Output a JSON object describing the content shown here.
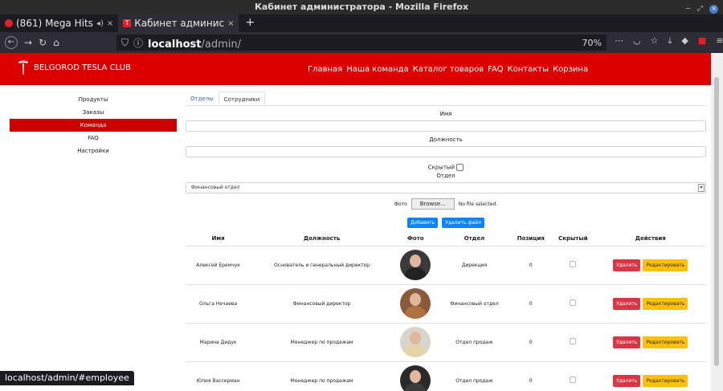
{
  "window": {
    "title": "Кабинет администратора - Mozilla Firefox"
  },
  "tabs": [
    {
      "label": "(861) Mega Hits",
      "close": "×"
    },
    {
      "label": "Кабинет админис",
      "close": "×"
    }
  ],
  "newtab": "+",
  "address": {
    "host": "localhost",
    "path": "/admin/",
    "zoom": "70%"
  },
  "site": {
    "brand": "BELGOROD TESLA CLUB",
    "menu": [
      "Главная",
      "Наша команда",
      "Каталог товаров",
      "FAQ",
      "Контакты",
      "Корзина"
    ]
  },
  "sidebar": [
    "Продукты",
    "Заказы",
    "Команда",
    "FAQ",
    "Настройки"
  ],
  "admin_tabs": [
    "Отделы",
    "Сотрудники"
  ],
  "form": {
    "name_label": "Имя",
    "position_label": "Должность",
    "hidden_label": "Скрытый",
    "department_label": "Отдел",
    "department_value": "Финансовый отдел",
    "photo_label": "Фото",
    "browse_label": "Browse...",
    "file_status": "No file selected.",
    "add_button": "Добавить",
    "delete_file_button": "Удалить файл"
  },
  "table": {
    "headers": [
      "Имя",
      "Должность",
      "Фото",
      "Отдел",
      "Позиция",
      "Скрытый",
      "Действия"
    ],
    "rows": [
      {
        "name": "Алексей Еремчук",
        "position": "Основатель и генеральный директор",
        "department": "Дирекция",
        "pos": "0"
      },
      {
        "name": "Ольга Нечаева",
        "position": "Финансовый директор",
        "department": "Финансовый отдел",
        "pos": "0"
      },
      {
        "name": "Марина Дидук",
        "position": "Менеджер по продажам",
        "department": "Отдел продаж",
        "pos": "0"
      },
      {
        "name": "Юлия Вассерман",
        "position": "Менеджер по продажам",
        "department": "Отдел продаж",
        "pos": "0"
      }
    ],
    "delete_label": "Удалить",
    "edit_label": "Редактировать"
  },
  "status_url": "localhost/admin/#employee",
  "colors": {
    "brand_red": "#dd0000",
    "primary": "#0d84ff",
    "danger": "#dc3545",
    "warning": "#ffc107"
  }
}
